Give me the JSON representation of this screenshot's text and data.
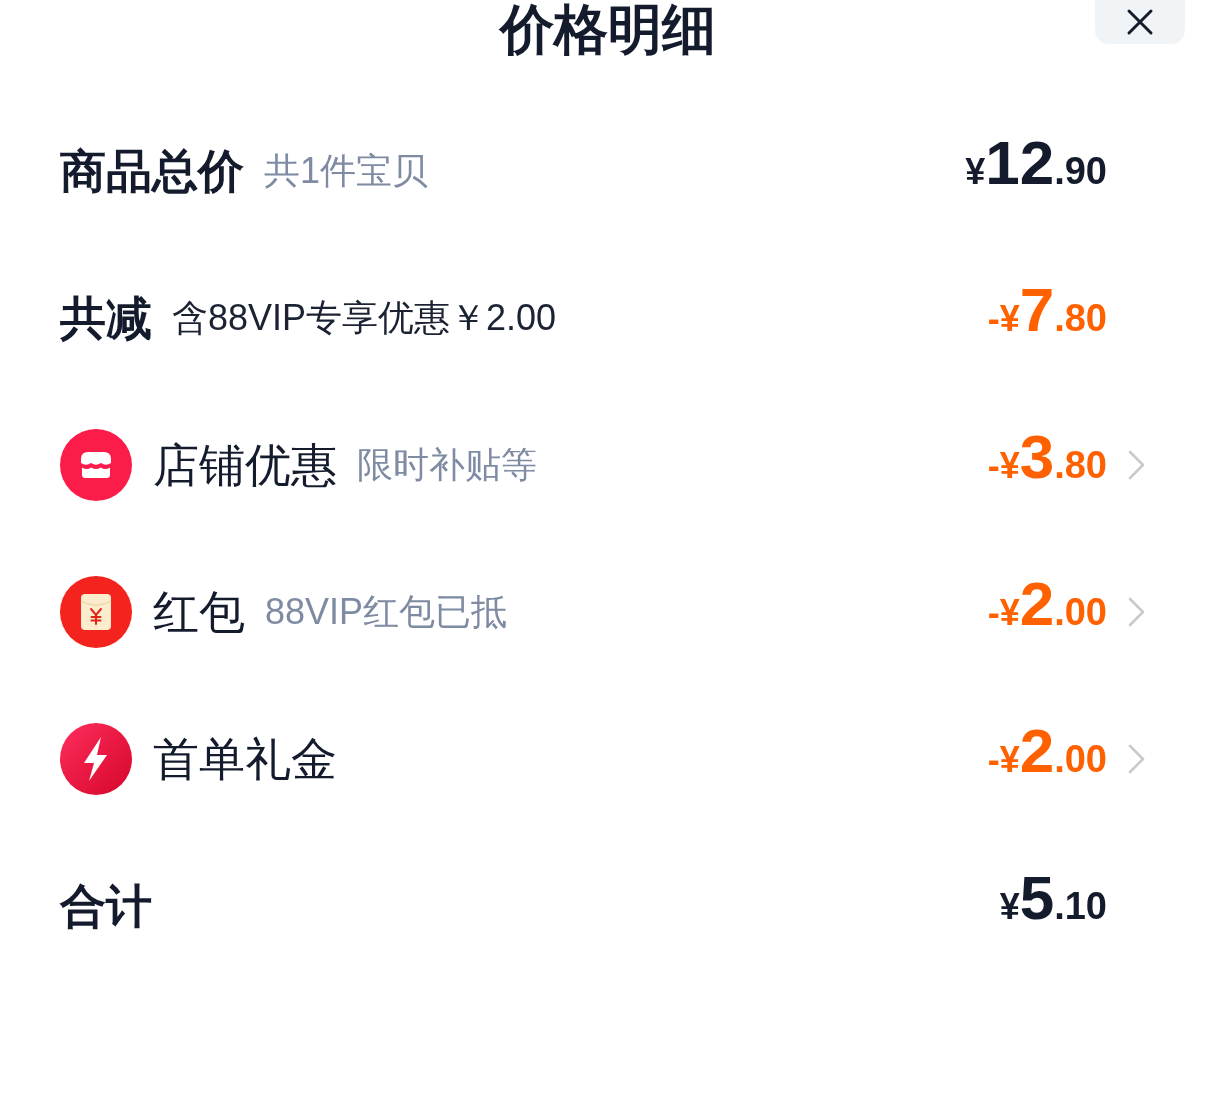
{
  "header": {
    "title": "价格明细"
  },
  "rows": [
    {
      "kind": "heading",
      "label": "商品总价",
      "note": "共1件宝贝",
      "note_muted": true,
      "amount": {
        "prefix": "¥",
        "integer": "12",
        "fraction": ".90"
      },
      "discount": false,
      "arrow": false
    },
    {
      "kind": "heading",
      "label": "共减",
      "note": "含88VIP专享优惠￥2.00",
      "note_muted": false,
      "amount": {
        "prefix": "-¥",
        "integer": "7",
        "fraction": ".80"
      },
      "discount": true,
      "arrow": false
    },
    {
      "kind": "store",
      "label": "店铺优惠",
      "note": "限时补贴等",
      "note_muted": true,
      "amount": {
        "prefix": "-¥",
        "integer": "3",
        "fraction": ".80"
      },
      "discount": true,
      "arrow": true
    },
    {
      "kind": "red_packet",
      "label": "红包",
      "note": "88VIP红包已抵",
      "note_muted": true,
      "amount": {
        "prefix": "-¥",
        "integer": "2",
        "fraction": ".00"
      },
      "discount": true,
      "arrow": true
    },
    {
      "kind": "bolt",
      "label": "首单礼金",
      "amount": {
        "prefix": "-¥",
        "integer": "2",
        "fraction": ".00"
      },
      "discount": true,
      "arrow": true
    },
    {
      "kind": "heading",
      "label": "合计",
      "amount": {
        "prefix": "¥",
        "integer": "5",
        "fraction": ".10"
      },
      "discount": false,
      "arrow": false
    }
  ]
}
